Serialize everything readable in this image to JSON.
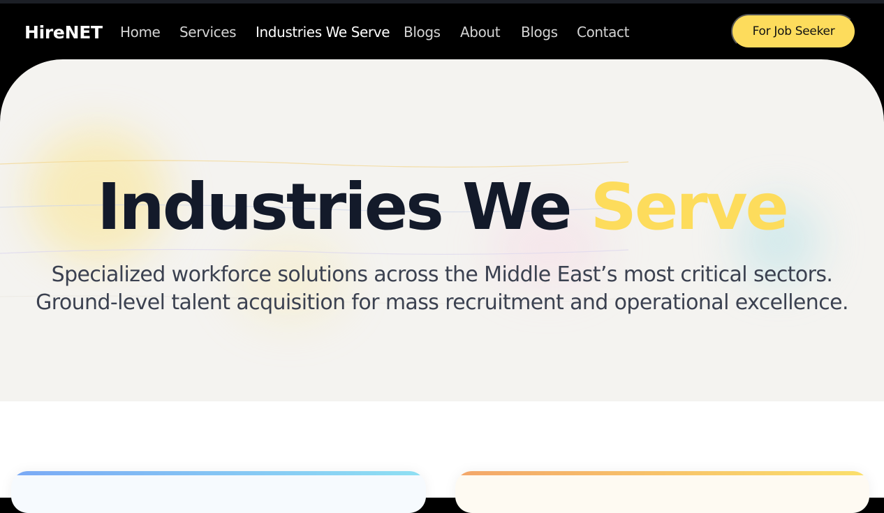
{
  "header": {
    "logo": "HireNET",
    "nav": [
      {
        "label": "Home",
        "active": false
      },
      {
        "label": "Services",
        "active": false
      },
      {
        "label": "Industries We Serve",
        "active": true
      },
      {
        "label": "Blogs",
        "active": false
      },
      {
        "label": "About",
        "active": false
      },
      {
        "label": "Blogs",
        "active": false
      },
      {
        "label": "Contact",
        "active": false
      }
    ],
    "cta_label": "For Job Seeker"
  },
  "hero": {
    "title_main": "Industries We",
    "title_accent": "Serve",
    "subtitle_line1": "Specialized workforce solutions across the Middle East’s most critical sectors.",
    "subtitle_line2": "Ground-level talent acquisition for mass recruitment and operational excellence."
  },
  "colors": {
    "accent": "#fddc5c",
    "nav_background": "#000000",
    "hero_background": "#f4f3f0",
    "title_text": "#131a2a"
  }
}
